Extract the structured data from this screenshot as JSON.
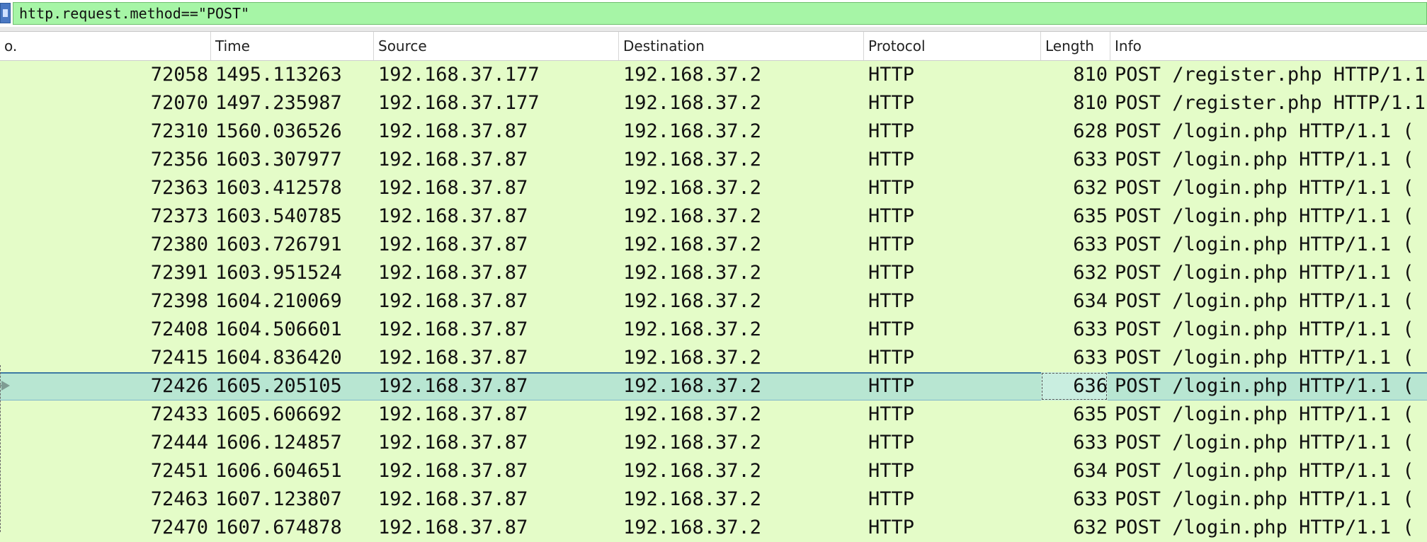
{
  "filter": {
    "value": "http.request.method==\"POST\""
  },
  "columns": {
    "no": "o.",
    "time": "Time",
    "source": "Source",
    "destination": "Destination",
    "protocol": "Protocol",
    "length": "Length",
    "info": "Info"
  },
  "selected_row_index": 11,
  "packets": [
    {
      "no": "72058",
      "time": "1495.113263",
      "source": "192.168.37.177",
      "destination": "192.168.37.2",
      "protocol": "HTTP",
      "length": "810",
      "info": "POST /register.php HTTP/1.1"
    },
    {
      "no": "72070",
      "time": "1497.235987",
      "source": "192.168.37.177",
      "destination": "192.168.37.2",
      "protocol": "HTTP",
      "length": "810",
      "info": "POST /register.php HTTP/1.1"
    },
    {
      "no": "72310",
      "time": "1560.036526",
      "source": "192.168.37.87",
      "destination": "192.168.37.2",
      "protocol": "HTTP",
      "length": "628",
      "info": "POST /login.php HTTP/1.1  ("
    },
    {
      "no": "72356",
      "time": "1603.307977",
      "source": "192.168.37.87",
      "destination": "192.168.37.2",
      "protocol": "HTTP",
      "length": "633",
      "info": "POST /login.php HTTP/1.1  ("
    },
    {
      "no": "72363",
      "time": "1603.412578",
      "source": "192.168.37.87",
      "destination": "192.168.37.2",
      "protocol": "HTTP",
      "length": "632",
      "info": "POST /login.php HTTP/1.1  ("
    },
    {
      "no": "72373",
      "time": "1603.540785",
      "source": "192.168.37.87",
      "destination": "192.168.37.2",
      "protocol": "HTTP",
      "length": "635",
      "info": "POST /login.php HTTP/1.1  ("
    },
    {
      "no": "72380",
      "time": "1603.726791",
      "source": "192.168.37.87",
      "destination": "192.168.37.2",
      "protocol": "HTTP",
      "length": "633",
      "info": "POST /login.php HTTP/1.1  ("
    },
    {
      "no": "72391",
      "time": "1603.951524",
      "source": "192.168.37.87",
      "destination": "192.168.37.2",
      "protocol": "HTTP",
      "length": "632",
      "info": "POST /login.php HTTP/1.1  ("
    },
    {
      "no": "72398",
      "time": "1604.210069",
      "source": "192.168.37.87",
      "destination": "192.168.37.2",
      "protocol": "HTTP",
      "length": "634",
      "info": "POST /login.php HTTP/1.1  ("
    },
    {
      "no": "72408",
      "time": "1604.506601",
      "source": "192.168.37.87",
      "destination": "192.168.37.2",
      "protocol": "HTTP",
      "length": "633",
      "info": "POST /login.php HTTP/1.1  ("
    },
    {
      "no": "72415",
      "time": "1604.836420",
      "source": "192.168.37.87",
      "destination": "192.168.37.2",
      "protocol": "HTTP",
      "length": "633",
      "info": "POST /login.php HTTP/1.1  ("
    },
    {
      "no": "72426",
      "time": "1605.205105",
      "source": "192.168.37.87",
      "destination": "192.168.37.2",
      "protocol": "HTTP",
      "length": "636",
      "info": "POST /login.php HTTP/1.1  ("
    },
    {
      "no": "72433",
      "time": "1605.606692",
      "source": "192.168.37.87",
      "destination": "192.168.37.2",
      "protocol": "HTTP",
      "length": "635",
      "info": "POST /login.php HTTP/1.1  ("
    },
    {
      "no": "72444",
      "time": "1606.124857",
      "source": "192.168.37.87",
      "destination": "192.168.37.2",
      "protocol": "HTTP",
      "length": "633",
      "info": "POST /login.php HTTP/1.1  ("
    },
    {
      "no": "72451",
      "time": "1606.604651",
      "source": "192.168.37.87",
      "destination": "192.168.37.2",
      "protocol": "HTTP",
      "length": "634",
      "info": "POST /login.php HTTP/1.1  ("
    },
    {
      "no": "72463",
      "time": "1607.123807",
      "source": "192.168.37.87",
      "destination": "192.168.37.2",
      "protocol": "HTTP",
      "length": "633",
      "info": "POST /login.php HTTP/1.1  ("
    },
    {
      "no": "72470",
      "time": "1607.674878",
      "source": "192.168.37.87",
      "destination": "192.168.37.2",
      "protocol": "HTTP",
      "length": "632",
      "info": "POST /login.php HTTP/1.1  ("
    }
  ],
  "colors": {
    "filter_valid_bg": "#a6f5a6",
    "row_bg": "#e4fcc8",
    "selected_row_bg": "#b8e6d2"
  }
}
